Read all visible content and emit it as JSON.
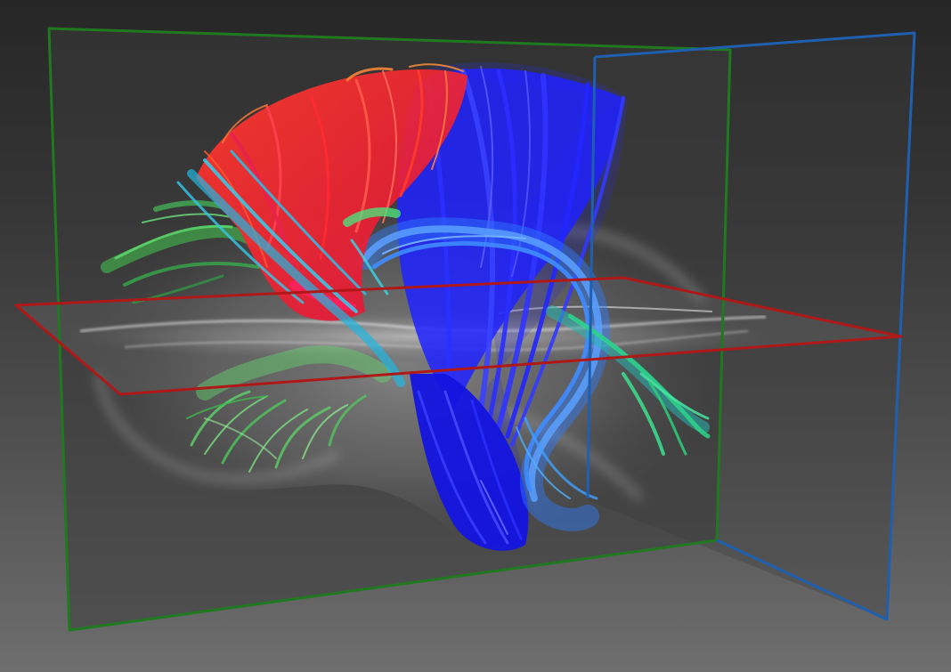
{
  "view": {
    "background_top": "#262626",
    "background_bottom": "#6e6e6e"
  },
  "planes": {
    "sagittal": {
      "color": "#1f7a1f"
    },
    "coronal": {
      "color": "#1f5fb0"
    },
    "axial": {
      "color": "#b01818"
    }
  },
  "fiber_colors": {
    "left_right": "#ff2020",
    "anterior_posterior": "#3ecf4f",
    "superior_inferior": "#1a24ff",
    "mixed": "#1e90ff"
  },
  "icons": {
    "fiber_tracts": "tractography-bundles",
    "brain_slices": "mri-slice"
  }
}
